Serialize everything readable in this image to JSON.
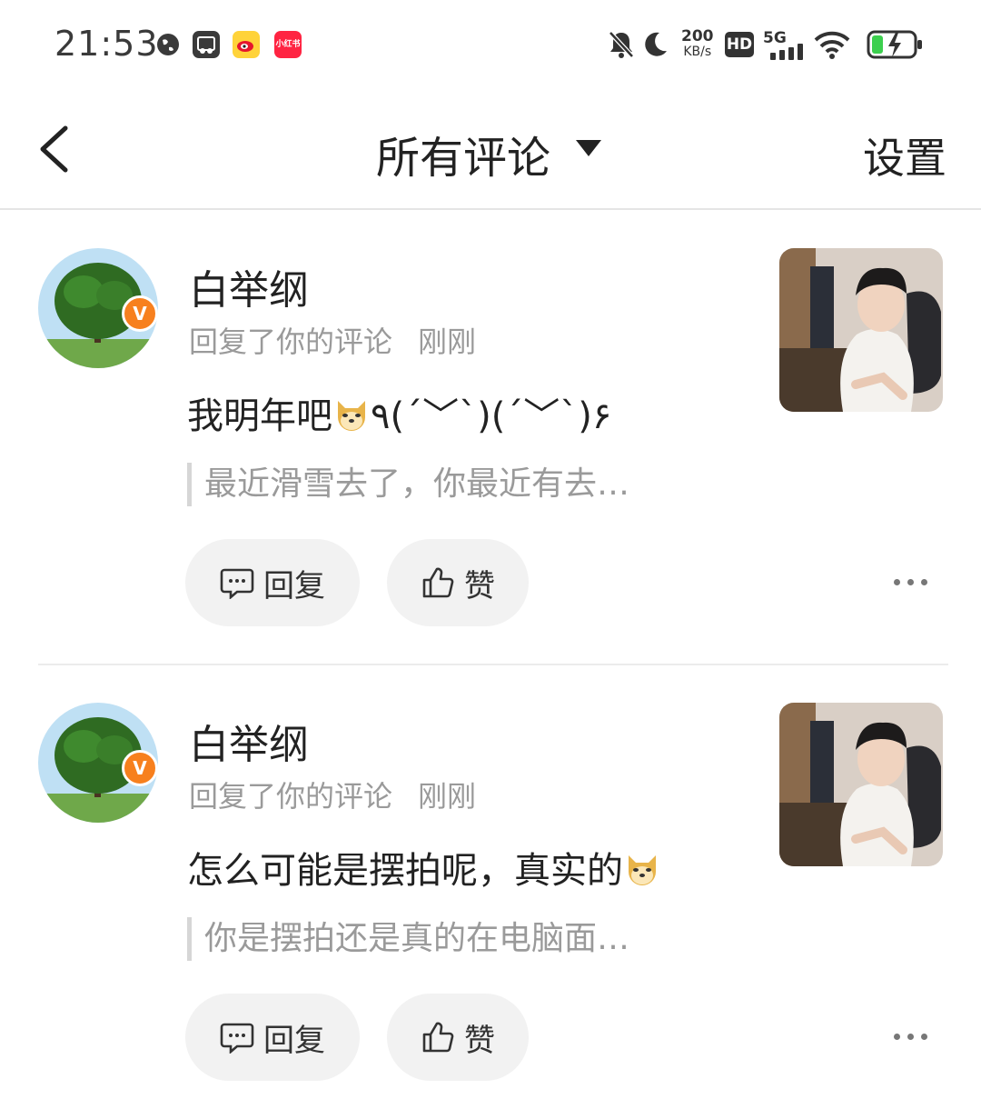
{
  "status_bar": {
    "time": "21:53",
    "speed_value": "200",
    "speed_unit": "KB/s",
    "hd": "HD",
    "network": "5G",
    "icons": [
      "globe-icon",
      "app-icon",
      "weibo-icon",
      "xiaohongshu-icon",
      "mute-icon",
      "moon-icon",
      "signal-icon",
      "wifi-icon",
      "battery-charging-icon"
    ],
    "xiaohongshu_label": "小红书"
  },
  "header": {
    "title": "所有评论",
    "settings": "设置"
  },
  "colors": {
    "badge": "#f7801e",
    "muted_text": "#9a9a9a",
    "pill_bg": "#f2f2f2"
  },
  "comments": [
    {
      "user": "白举纲",
      "action": "回复了你的评论",
      "time": "刚刚",
      "text_before": "我明年吧",
      "text_after": "٩(ˊ﹀ˋ)(ˊ﹀ˋ)۶",
      "quote": "最近滑雪去了，你最近有去…",
      "reply_label": "回复",
      "like_label": "赞"
    },
    {
      "user": "白举纲",
      "action": "回复了你的评论",
      "time": "刚刚",
      "text_before": "怎么可能是摆拍呢，真实的",
      "text_after": "",
      "quote": "你是摆拍还是真的在电脑面…",
      "reply_label": "回复",
      "like_label": "赞"
    }
  ]
}
